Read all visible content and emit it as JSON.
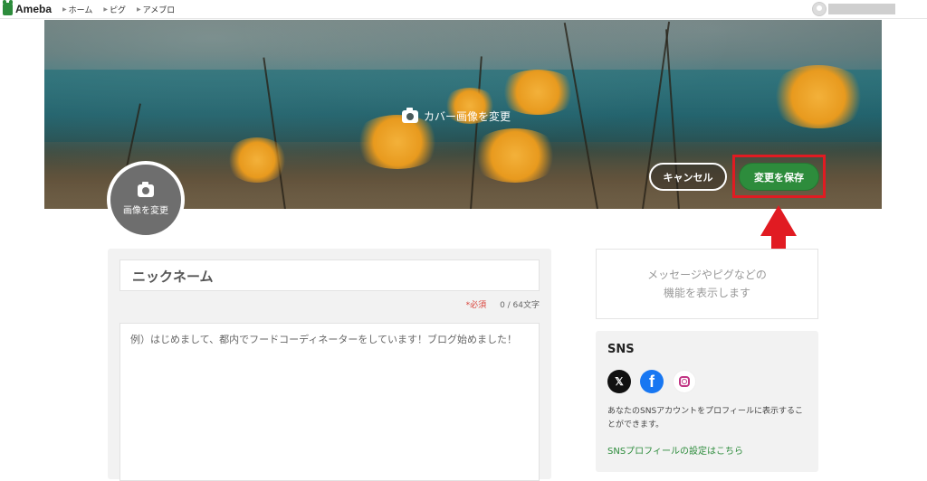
{
  "header": {
    "brand": "Ameba",
    "nav": [
      {
        "label": "ホーム"
      },
      {
        "label": "ピグ"
      },
      {
        "label": "アメブロ"
      }
    ]
  },
  "cover": {
    "change_label": "カバー画像を変更",
    "cancel_label": "キャンセル",
    "save_label": "変更を保存",
    "highlight_color": "#e11b22",
    "save_color": "#2d8c3c"
  },
  "avatar": {
    "change_label": "画像を変更"
  },
  "profile_form": {
    "nickname_placeholder": "ニックネーム",
    "required_label": "*必須",
    "counter": "0 / 64文字",
    "bio_placeholder": "例）はじめまして、都内でフードコーディネーターをしています！ブログ始めました！"
  },
  "sidebar": {
    "message_line1": "メッセージやピグなどの",
    "message_line2": "機能を表示します",
    "sns": {
      "title": "SNS",
      "icons": [
        "x-icon",
        "facebook-icon",
        "instagram-icon"
      ],
      "x_glyph": "𝕏",
      "fb_glyph": "f",
      "description": "あなたのSNSアカウントをプロフィールに表示することができます。",
      "settings_link": "SNSプロフィールの設定はこちら"
    }
  }
}
